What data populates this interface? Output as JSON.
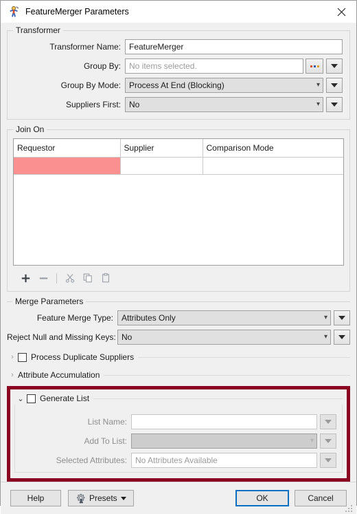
{
  "window": {
    "title": "FeatureMerger Parameters",
    "icon": "transformer-icon",
    "close_label": "✕"
  },
  "transformer": {
    "legend": "Transformer",
    "rows": [
      {
        "label": "Transformer Name:",
        "value": "FeatureMerger",
        "type": "text",
        "placeholder": ""
      },
      {
        "label": "Group By:",
        "value": "",
        "placeholder": "No items selected.",
        "type": "text-browse"
      },
      {
        "label": "Group By Mode:",
        "value": "Process At End (Blocking)",
        "type": "combo"
      },
      {
        "label": "Suppliers First:",
        "value": "No",
        "type": "combo"
      }
    ]
  },
  "join_on": {
    "legend": "Join On",
    "columns": [
      "Requestor",
      "Supplier",
      "Comparison Mode"
    ],
    "rows": [
      {
        "requestor": "",
        "supplier": "",
        "comparison_mode": "",
        "requestor_error": true
      }
    ],
    "toolbar": [
      {
        "name": "add-row-button",
        "icon": "plus-icon",
        "enabled": true
      },
      {
        "name": "remove-row-button",
        "icon": "minus-icon",
        "enabled": false
      },
      {
        "name": "cut-button",
        "icon": "scissors-icon",
        "enabled": false
      },
      {
        "name": "copy-button",
        "icon": "copy-icon",
        "enabled": false
      },
      {
        "name": "paste-button",
        "icon": "clipboard-icon",
        "enabled": false
      }
    ]
  },
  "merge_parameters": {
    "legend": "Merge Parameters",
    "rows": [
      {
        "label": "Feature Merge Type:",
        "value": "Attributes Only",
        "type": "combo"
      },
      {
        "label": "Reject Null and Missing Keys:",
        "value": "No",
        "type": "combo"
      }
    ],
    "collapsibles": [
      {
        "label": "Process Duplicate Suppliers",
        "expanded": false,
        "has_checkbox": true,
        "checked": false,
        "arrow": "›"
      },
      {
        "label": "Attribute Accumulation",
        "expanded": false,
        "has_checkbox": false,
        "checked": false,
        "arrow": "›"
      }
    ]
  },
  "generate_list": {
    "label": "Generate List",
    "expanded": true,
    "checked": false,
    "arrow": "⌄",
    "highlight_color": "#8b0020",
    "rows": [
      {
        "label": "List Name:",
        "value": "",
        "placeholder": "",
        "type": "text",
        "disabled": true
      },
      {
        "label": "Add To List:",
        "value": "",
        "type": "combo",
        "disabled": true
      },
      {
        "label": "Selected Attributes:",
        "value": "No Attributes Available",
        "type": "text",
        "disabled": true
      }
    ]
  },
  "footer": {
    "help_label": "Help",
    "presets_label": "Presets",
    "presets_icon": "gear-person-icon",
    "ok_label": "OK",
    "cancel_label": "Cancel"
  },
  "colors": {
    "error_cell": "#fa9090",
    "highlight_border": "#8b0020",
    "focus_border": "#0a6fc2",
    "dialog_bg": "#f0f0f0"
  }
}
